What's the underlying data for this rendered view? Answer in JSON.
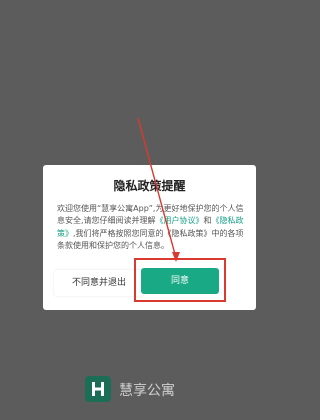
{
  "dialog": {
    "title": "隐私政策提醒",
    "body_intro": "欢迎您使用“慧享公寓App”,为更好地保护您的个人信息安全,请您仔细阅读并理解",
    "user_agreement_link": "《用户协议》",
    "and_text": "和",
    "privacy_policy_link": "《隐私政策》",
    "body_outro": ",我们将严格按照您同意的《隐私政策》中的各项条款使用和保护您的个人信息。",
    "disagree_button": "不同意并退出",
    "agree_button": "同意"
  },
  "brand": {
    "icon": "h-logo-icon",
    "name": "慧享公寓"
  },
  "colors": {
    "accent": "#1aa985",
    "annotation": "#d9392e",
    "overlay": "#5c5c5c"
  }
}
